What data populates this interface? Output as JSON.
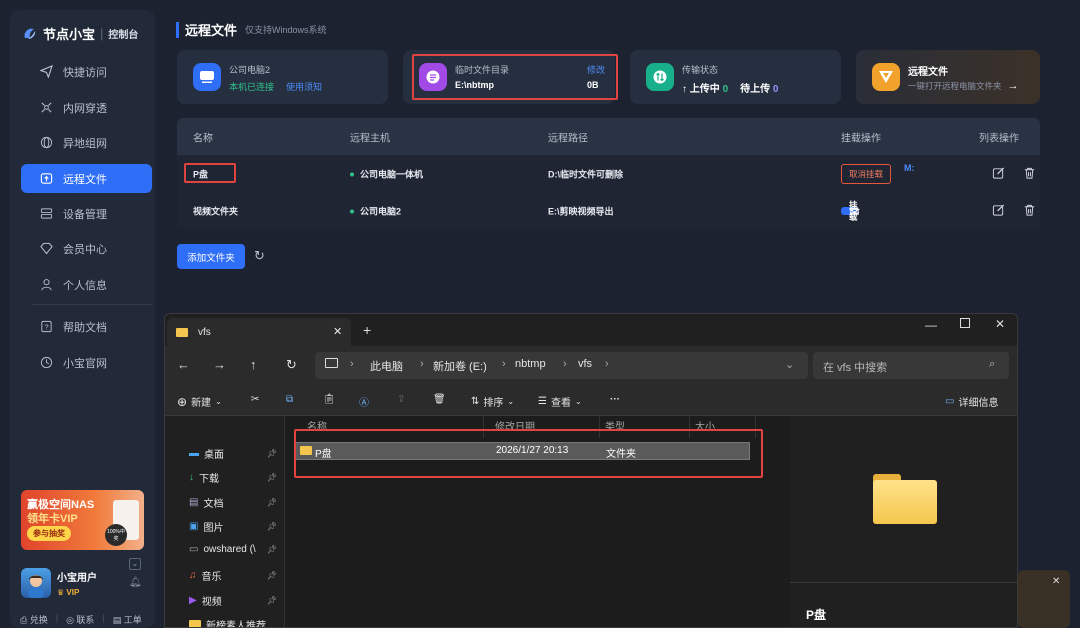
{
  "app": {
    "name": "节点小宝",
    "console": "控制台"
  },
  "nav": [
    {
      "label": "快捷访问",
      "icon": "send-icon"
    },
    {
      "label": "内网穿透",
      "icon": "network-icon"
    },
    {
      "label": "异地组网",
      "icon": "globe-icon"
    },
    {
      "label": "远程文件",
      "icon": "upload-folder-icon"
    },
    {
      "label": "设备管理",
      "icon": "device-icon"
    },
    {
      "label": "会员中心",
      "icon": "diamond-icon"
    },
    {
      "label": "个人信息",
      "icon": "person-icon"
    },
    {
      "label": "帮助文档",
      "icon": "help-icon"
    },
    {
      "label": "小宝官网",
      "icon": "clock-icon"
    }
  ],
  "promo": {
    "line1": "赢极空间NAS",
    "line2": "领年卡VIP",
    "button": "参与抽奖",
    "badge": "100%中奖"
  },
  "user": {
    "name": "小宝用户",
    "vip": "VIP"
  },
  "bottom_links": [
    "兑换",
    "联系",
    "工单"
  ],
  "header": {
    "title": "远程文件",
    "subtitle": "仅支持Windows系统"
  },
  "cards": {
    "pc": {
      "title": "公司电脑2",
      "status": "本机已连接",
      "link": "使用须知"
    },
    "temp": {
      "title": "临时文件目录",
      "path": "E:\\nbtmp",
      "edit": "修改",
      "size": "0B"
    },
    "transfer": {
      "title": "传输状态",
      "uploading_label": "上传中",
      "uploading": "0",
      "pending_label": "待上传",
      "pending": "0"
    },
    "remote": {
      "title": "远程文件",
      "desc": "一键打开远程电脑文件夹"
    }
  },
  "table": {
    "headers": [
      "名称",
      "远程主机",
      "远程路径",
      "挂载操作",
      "列表操作"
    ],
    "rows": [
      {
        "name": "P盘",
        "host": "公司电脑一体机",
        "path": "D:\\临时文件可删除",
        "action": "取消挂载",
        "drive": "M:"
      },
      {
        "name": "视频文件夹",
        "host": "公司电脑2",
        "path": "E:\\剪映视频导出",
        "action": "挂载",
        "drive": ""
      }
    ]
  },
  "add_button": "添加文件夹",
  "explorer": {
    "tab": "vfs",
    "breadcrumb": [
      "此电脑",
      "新加卷 (E:)",
      "nbtmp",
      "vfs"
    ],
    "search_placeholder": "在 vfs 中搜索",
    "toolbar": {
      "new": "新建",
      "sort": "排序",
      "view": "查看",
      "details": "详细信息"
    },
    "columns": [
      "名称",
      "修改日期",
      "类型",
      "大小"
    ],
    "quick": [
      "桌面",
      "下载",
      "文档",
      "图片",
      "owshared (\\",
      "音乐",
      "视频",
      "新榜素人推荐"
    ],
    "file": {
      "name": "P盘",
      "date": "2026/1/27 20:13",
      "type": "文件夹"
    },
    "preview_name": "P盘"
  }
}
